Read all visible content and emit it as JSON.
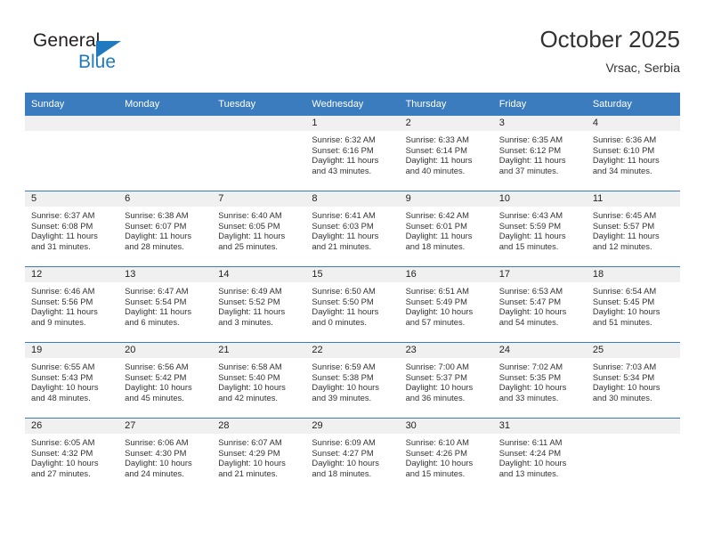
{
  "brand": {
    "name_top": "General",
    "name_bottom": "Blue",
    "accent_color": "#1f7ac0"
  },
  "header": {
    "title": "October 2025",
    "location": "Vrsac, Serbia"
  },
  "theme": {
    "header_bg": "#3a7cbe",
    "daynum_bg": "#f0f0f0",
    "text_color": "#333333"
  },
  "weekday_headers": [
    "Sunday",
    "Monday",
    "Tuesday",
    "Wednesday",
    "Thursday",
    "Friday",
    "Saturday"
  ],
  "labels": {
    "sunrise": "Sunrise:",
    "sunset": "Sunset:",
    "daylight": "Daylight:"
  },
  "weeks": [
    [
      {
        "day": "",
        "line1": "",
        "line2": "",
        "line3": "",
        "line4": ""
      },
      {
        "day": "",
        "line1": "",
        "line2": "",
        "line3": "",
        "line4": ""
      },
      {
        "day": "",
        "line1": "",
        "line2": "",
        "line3": "",
        "line4": ""
      },
      {
        "day": "1",
        "line1": "Sunrise: 6:32 AM",
        "line2": "Sunset: 6:16 PM",
        "line3": "Daylight: 11 hours",
        "line4": "and 43 minutes."
      },
      {
        "day": "2",
        "line1": "Sunrise: 6:33 AM",
        "line2": "Sunset: 6:14 PM",
        "line3": "Daylight: 11 hours",
        "line4": "and 40 minutes."
      },
      {
        "day": "3",
        "line1": "Sunrise: 6:35 AM",
        "line2": "Sunset: 6:12 PM",
        "line3": "Daylight: 11 hours",
        "line4": "and 37 minutes."
      },
      {
        "day": "4",
        "line1": "Sunrise: 6:36 AM",
        "line2": "Sunset: 6:10 PM",
        "line3": "Daylight: 11 hours",
        "line4": "and 34 minutes."
      }
    ],
    [
      {
        "day": "5",
        "line1": "Sunrise: 6:37 AM",
        "line2": "Sunset: 6:08 PM",
        "line3": "Daylight: 11 hours",
        "line4": "and 31 minutes."
      },
      {
        "day": "6",
        "line1": "Sunrise: 6:38 AM",
        "line2": "Sunset: 6:07 PM",
        "line3": "Daylight: 11 hours",
        "line4": "and 28 minutes."
      },
      {
        "day": "7",
        "line1": "Sunrise: 6:40 AM",
        "line2": "Sunset: 6:05 PM",
        "line3": "Daylight: 11 hours",
        "line4": "and 25 minutes."
      },
      {
        "day": "8",
        "line1": "Sunrise: 6:41 AM",
        "line2": "Sunset: 6:03 PM",
        "line3": "Daylight: 11 hours",
        "line4": "and 21 minutes."
      },
      {
        "day": "9",
        "line1": "Sunrise: 6:42 AM",
        "line2": "Sunset: 6:01 PM",
        "line3": "Daylight: 11 hours",
        "line4": "and 18 minutes."
      },
      {
        "day": "10",
        "line1": "Sunrise: 6:43 AM",
        "line2": "Sunset: 5:59 PM",
        "line3": "Daylight: 11 hours",
        "line4": "and 15 minutes."
      },
      {
        "day": "11",
        "line1": "Sunrise: 6:45 AM",
        "line2": "Sunset: 5:57 PM",
        "line3": "Daylight: 11 hours",
        "line4": "and 12 minutes."
      }
    ],
    [
      {
        "day": "12",
        "line1": "Sunrise: 6:46 AM",
        "line2": "Sunset: 5:56 PM",
        "line3": "Daylight: 11 hours",
        "line4": "and 9 minutes."
      },
      {
        "day": "13",
        "line1": "Sunrise: 6:47 AM",
        "line2": "Sunset: 5:54 PM",
        "line3": "Daylight: 11 hours",
        "line4": "and 6 minutes."
      },
      {
        "day": "14",
        "line1": "Sunrise: 6:49 AM",
        "line2": "Sunset: 5:52 PM",
        "line3": "Daylight: 11 hours",
        "line4": "and 3 minutes."
      },
      {
        "day": "15",
        "line1": "Sunrise: 6:50 AM",
        "line2": "Sunset: 5:50 PM",
        "line3": "Daylight: 11 hours",
        "line4": "and 0 minutes."
      },
      {
        "day": "16",
        "line1": "Sunrise: 6:51 AM",
        "line2": "Sunset: 5:49 PM",
        "line3": "Daylight: 10 hours",
        "line4": "and 57 minutes."
      },
      {
        "day": "17",
        "line1": "Sunrise: 6:53 AM",
        "line2": "Sunset: 5:47 PM",
        "line3": "Daylight: 10 hours",
        "line4": "and 54 minutes."
      },
      {
        "day": "18",
        "line1": "Sunrise: 6:54 AM",
        "line2": "Sunset: 5:45 PM",
        "line3": "Daylight: 10 hours",
        "line4": "and 51 minutes."
      }
    ],
    [
      {
        "day": "19",
        "line1": "Sunrise: 6:55 AM",
        "line2": "Sunset: 5:43 PM",
        "line3": "Daylight: 10 hours",
        "line4": "and 48 minutes."
      },
      {
        "day": "20",
        "line1": "Sunrise: 6:56 AM",
        "line2": "Sunset: 5:42 PM",
        "line3": "Daylight: 10 hours",
        "line4": "and 45 minutes."
      },
      {
        "day": "21",
        "line1": "Sunrise: 6:58 AM",
        "line2": "Sunset: 5:40 PM",
        "line3": "Daylight: 10 hours",
        "line4": "and 42 minutes."
      },
      {
        "day": "22",
        "line1": "Sunrise: 6:59 AM",
        "line2": "Sunset: 5:38 PM",
        "line3": "Daylight: 10 hours",
        "line4": "and 39 minutes."
      },
      {
        "day": "23",
        "line1": "Sunrise: 7:00 AM",
        "line2": "Sunset: 5:37 PM",
        "line3": "Daylight: 10 hours",
        "line4": "and 36 minutes."
      },
      {
        "day": "24",
        "line1": "Sunrise: 7:02 AM",
        "line2": "Sunset: 5:35 PM",
        "line3": "Daylight: 10 hours",
        "line4": "and 33 minutes."
      },
      {
        "day": "25",
        "line1": "Sunrise: 7:03 AM",
        "line2": "Sunset: 5:34 PM",
        "line3": "Daylight: 10 hours",
        "line4": "and 30 minutes."
      }
    ],
    [
      {
        "day": "26",
        "line1": "Sunrise: 6:05 AM",
        "line2": "Sunset: 4:32 PM",
        "line3": "Daylight: 10 hours",
        "line4": "and 27 minutes."
      },
      {
        "day": "27",
        "line1": "Sunrise: 6:06 AM",
        "line2": "Sunset: 4:30 PM",
        "line3": "Daylight: 10 hours",
        "line4": "and 24 minutes."
      },
      {
        "day": "28",
        "line1": "Sunrise: 6:07 AM",
        "line2": "Sunset: 4:29 PM",
        "line3": "Daylight: 10 hours",
        "line4": "and 21 minutes."
      },
      {
        "day": "29",
        "line1": "Sunrise: 6:09 AM",
        "line2": "Sunset: 4:27 PM",
        "line3": "Daylight: 10 hours",
        "line4": "and 18 minutes."
      },
      {
        "day": "30",
        "line1": "Sunrise: 6:10 AM",
        "line2": "Sunset: 4:26 PM",
        "line3": "Daylight: 10 hours",
        "line4": "and 15 minutes."
      },
      {
        "day": "31",
        "line1": "Sunrise: 6:11 AM",
        "line2": "Sunset: 4:24 PM",
        "line3": "Daylight: 10 hours",
        "line4": "and 13 minutes."
      },
      {
        "day": "",
        "line1": "",
        "line2": "",
        "line3": "",
        "line4": ""
      }
    ]
  ]
}
